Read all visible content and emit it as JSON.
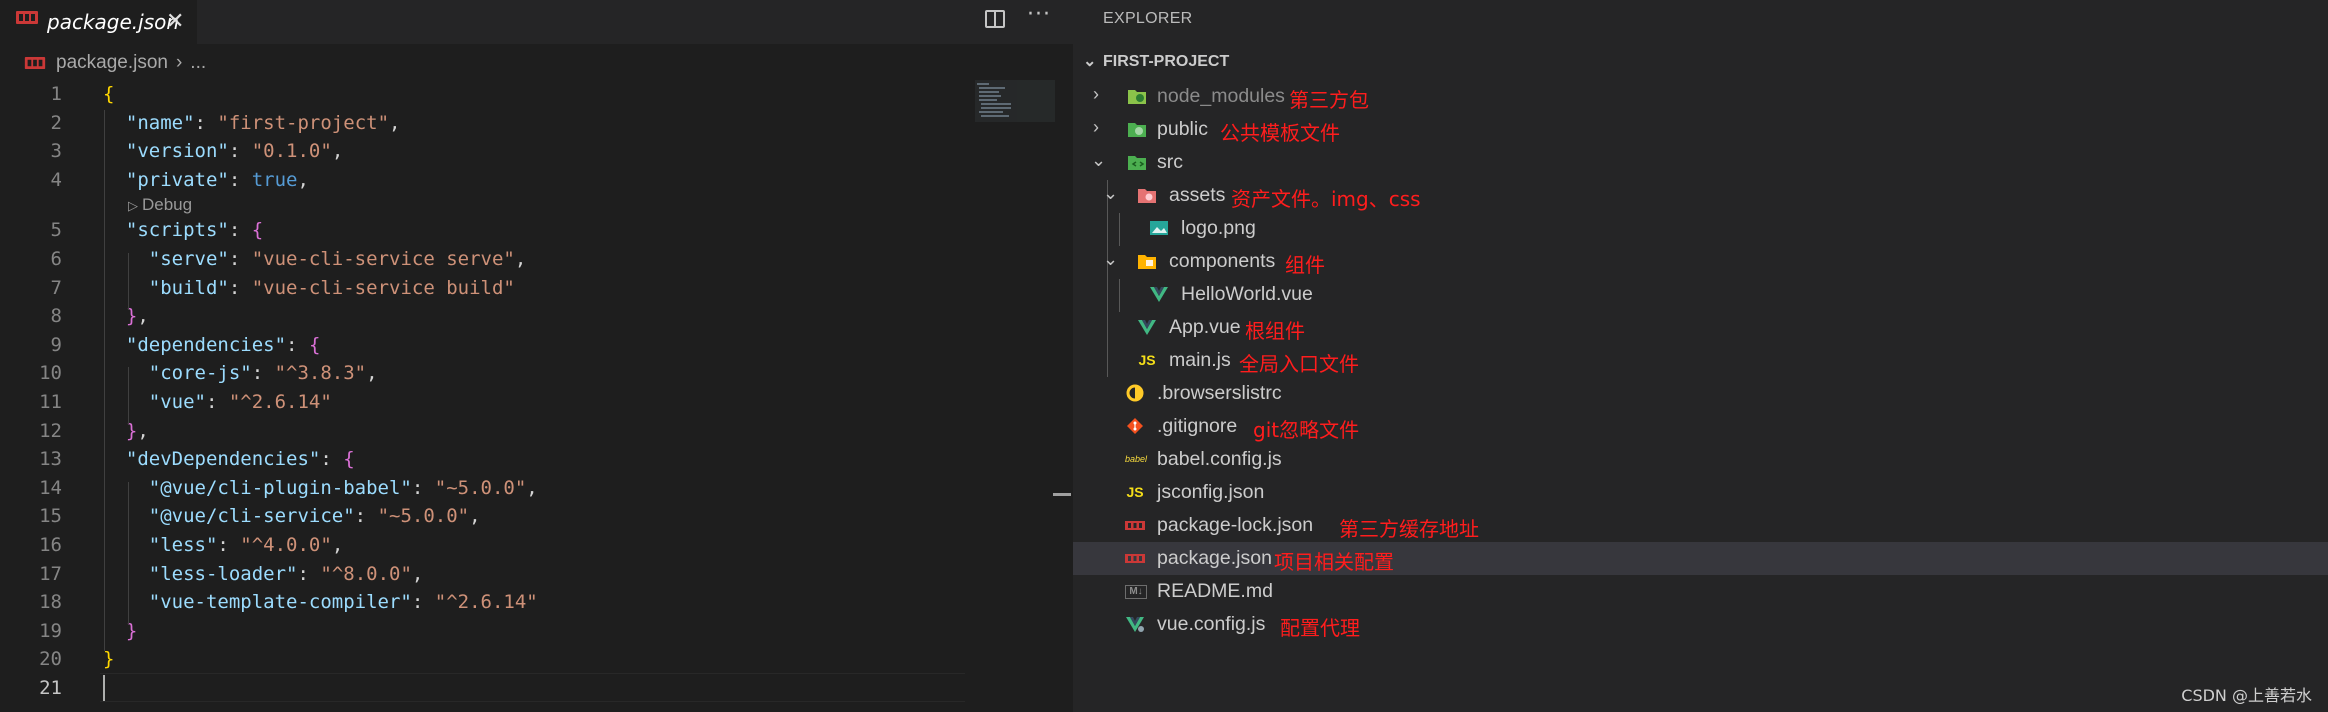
{
  "tab": {
    "title": "package.json",
    "close_glyph": "✕",
    "icon": "npm-icon"
  },
  "breadcrumb": {
    "file": "package.json",
    "separator": "›",
    "ellipsis": "..."
  },
  "codelens": {
    "label": "Debug"
  },
  "line_numbers": [
    "1",
    "2",
    "3",
    "4",
    "5",
    "6",
    "7",
    "8",
    "9",
    "10",
    "11",
    "12",
    "13",
    "14",
    "15",
    "16",
    "17",
    "18",
    "19",
    "20",
    "21"
  ],
  "code": {
    "l1": "{",
    "l2_key": "\"name\"",
    "l2_val": "\"first-project\"",
    "l3_key": "\"version\"",
    "l3_val": "\"0.1.0\"",
    "l4_key": "\"private\"",
    "l4_val": "true",
    "l5_key": "\"scripts\"",
    "l5_brace": "{",
    "l6_key": "\"serve\"",
    "l6_val": "\"vue-cli-service serve\"",
    "l7_key": "\"build\"",
    "l7_val": "\"vue-cli-service build\"",
    "l8": "}",
    "l9_key": "\"dependencies\"",
    "l9_brace": "{",
    "l10_key": "\"core-js\"",
    "l10_val": "\"^3.8.3\"",
    "l11_key": "\"vue\"",
    "l11_val": "\"^2.6.14\"",
    "l12": "}",
    "l13_key": "\"devDependencies\"",
    "l13_brace": "{",
    "l14_key": "\"@vue/cli-plugin-babel\"",
    "l14_val": "\"~5.0.0\"",
    "l15_key": "\"@vue/cli-service\"",
    "l15_val": "\"~5.0.0\"",
    "l16_key": "\"less\"",
    "l16_val": "\"^4.0.0\"",
    "l17_key": "\"less-loader\"",
    "l17_val": "\"^8.0.0\"",
    "l18_key": "\"vue-template-compiler\"",
    "l18_val": "\"^2.6.14\"",
    "l19": "}",
    "l20": "}"
  },
  "explorer": {
    "title": "EXPLORER",
    "project": "FIRST-PROJECT",
    "items": [
      {
        "label": "node_modules",
        "note": "第三方包",
        "icon": "node-folder-icon"
      },
      {
        "label": "public",
        "note": "公共模板文件",
        "icon": "public-folder-icon"
      },
      {
        "label": "src",
        "note": "",
        "icon": "src-folder-icon"
      },
      {
        "label": "assets",
        "note": "资产文件。img、css",
        "icon": "assets-folder-icon"
      },
      {
        "label": "logo.png",
        "note": "",
        "icon": "image-icon"
      },
      {
        "label": "components",
        "note": "组件",
        "icon": "components-folder-icon"
      },
      {
        "label": "HelloWorld.vue",
        "note": "",
        "icon": "vue-icon"
      },
      {
        "label": "App.vue",
        "note": "根组件",
        "icon": "vue-icon"
      },
      {
        "label": "main.js",
        "note": "全局入口文件",
        "icon": "js-icon"
      },
      {
        "label": ".browserslistrc",
        "note": "",
        "icon": "browserslist-icon"
      },
      {
        "label": ".gitignore",
        "note": "git忽略文件",
        "icon": "git-icon"
      },
      {
        "label": "babel.config.js",
        "note": "",
        "icon": "babel-icon"
      },
      {
        "label": "jsconfig.json",
        "note": "",
        "icon": "jsconfig-icon"
      },
      {
        "label": "package-lock.json",
        "note": "第三方缓存地址",
        "icon": "npm-icon"
      },
      {
        "label": "package.json",
        "note": "项目相关配置",
        "icon": "npm-icon"
      },
      {
        "label": "README.md",
        "note": "",
        "icon": "markdown-icon"
      },
      {
        "label": "vue.config.js",
        "note": "配置代理",
        "icon": "vue-config-icon"
      }
    ]
  },
  "icon_text": {
    "js": "JS",
    "md": "M↓",
    "babel": "babel"
  },
  "watermark": "CSDN @上善若水",
  "colors": {
    "accent_note": "#ff1d1d",
    "selection": "#37373d",
    "string": "#ce9178",
    "key": "#9cdcfe"
  }
}
